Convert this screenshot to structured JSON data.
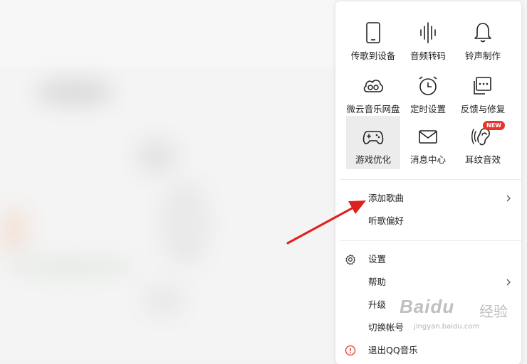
{
  "grid": [
    {
      "label": "传歌到设备",
      "icon": "phone-icon"
    },
    {
      "label": "音频转码",
      "icon": "audio-waveform-icon"
    },
    {
      "label": "铃声制作",
      "icon": "bell-icon"
    },
    {
      "label": "微云音乐网盘",
      "icon": "cloud-icon"
    },
    {
      "label": "定时设置",
      "icon": "alarm-clock-icon"
    },
    {
      "label": "反馈与修复",
      "icon": "feedback-icon"
    },
    {
      "label": "游戏优化",
      "icon": "gamepad-icon"
    },
    {
      "label": "消息中心",
      "icon": "envelope-icon"
    },
    {
      "label": "耳纹音效",
      "icon": "ear-icon"
    }
  ],
  "badge": "NEW",
  "menu": [
    {
      "label": "添加歌曲",
      "has_submenu": true
    },
    {
      "label": "听歌偏好",
      "has_submenu": false
    },
    {
      "label": "设置",
      "has_submenu": false,
      "icon": "gear-icon"
    },
    {
      "label": "帮助",
      "has_submenu": true
    },
    {
      "label": "升级",
      "has_submenu": false
    },
    {
      "label": "切换帐号",
      "has_submenu": false
    },
    {
      "label": "退出QQ音乐",
      "has_submenu": false,
      "icon": "exit-icon"
    }
  ],
  "watermark": {
    "brand": "Baidu",
    "sub": "经验",
    "url": "jingyan.baidu.com"
  },
  "colors": {
    "accent": "#e8342a",
    "arrow": "#e0201c"
  }
}
